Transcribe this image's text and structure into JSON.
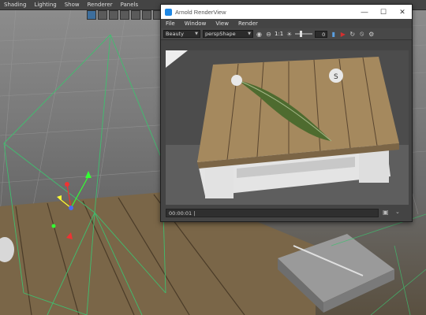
{
  "maya": {
    "menu": [
      "Shading",
      "Lighting",
      "Show",
      "Renderer",
      "Panels"
    ]
  },
  "render_view": {
    "title": "Arnold RenderView",
    "window_controls": {
      "minimize": "—",
      "maximize": "☐",
      "close": "✕"
    },
    "menu": [
      "File",
      "Window",
      "View",
      "Render"
    ],
    "toolbar": {
      "aov_value": "Beauty",
      "camera_value": "perspShape",
      "ratio_label": "1:1",
      "exposure_value": "0"
    },
    "status_text": "00:00:01 |",
    "colors": {
      "render_button": "#d32f2f",
      "title_icon": "#1e88e5"
    },
    "icons": {
      "app": "arnold-app-icon",
      "display": "display-settings-icon",
      "region": "crop-region-icon",
      "exposure": "exposure-icon",
      "lock": "lock-icon",
      "render": "render-play-icon",
      "refresh": "refresh-icon",
      "stop": "stop-icon",
      "settings": "gear-icon",
      "snapshot": "snapshot-icon",
      "expand": "chevron-down-icon"
    }
  }
}
